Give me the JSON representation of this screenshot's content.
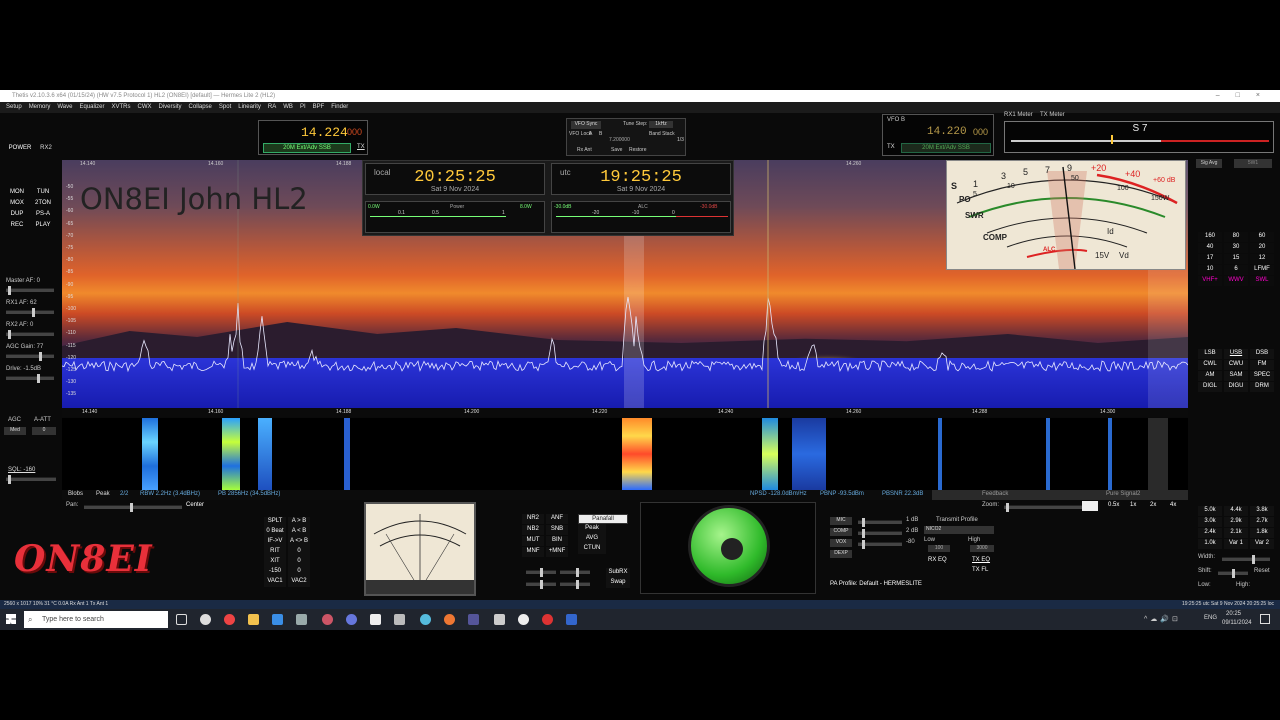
{
  "window": {
    "title": "Thetis v2.10.3.6 x64 (01/15/24) (HW v7.5 Protocol 1) HL2 (ON8EI) [default] — Hermes Lite 2 (HL2)"
  },
  "menu": [
    "Setup",
    "Memory",
    "Wave",
    "Equalizer",
    "XVTRs",
    "CWX",
    "Diversity",
    "Collapse",
    "Spot",
    "Linearity",
    "RA",
    "WB",
    "PI",
    "BPF",
    "Finder"
  ],
  "vfo_a": {
    "freq_main": "14.224",
    "freq_sub": "000",
    "band": "20M Ext/Adv SSB",
    "tx_label": "TX"
  },
  "vfo_b": {
    "label": "VFO B",
    "freq_main": "14.220",
    "freq_sub": "000",
    "band": "20M Ext/Adv SSB",
    "tx_label": "TX"
  },
  "vfo_sync": {
    "label": "VFO Sync",
    "tune_step_label": "Tune Step:",
    "tune_step": "1kHz",
    "vfo_lock": "VFO Lock",
    "a": "A",
    "b": "B",
    "rx_ant": "Rx Ant",
    "save": "Save",
    "restore": "Restore",
    "band_stack": "Band Stack",
    "bs_value": "1/3",
    "vfo_val": "7.200000"
  },
  "left_buttons": [
    "MON",
    "TUN",
    "MOX",
    "2TON",
    "DUP",
    "PS-A",
    "REC",
    "PLAY"
  ],
  "power": {
    "label": "POWER",
    "rx2": "RX2"
  },
  "left_sliders": [
    {
      "label": "Master AF: 0",
      "pos": 0.05
    },
    {
      "label": "RX1 AF: 62",
      "pos": 0.6
    },
    {
      "label": "RX2 AF: 0",
      "pos": 0.05
    },
    {
      "label": "AGC Gain: 77",
      "pos": 0.75
    },
    {
      "label": "Drive: -1.5dB",
      "pos": 0.7
    }
  ],
  "agc": {
    "label": "AGC",
    "att_label": "A-ATT",
    "agc_value": "Med",
    "att_value": "0",
    "sql_label": "SQL: -160"
  },
  "clocks": {
    "local": {
      "zone": "local",
      "time": "20:25:25",
      "date": "Sat 9 Nov 2024"
    },
    "utc": {
      "zone": "utc",
      "time": "19:25:25",
      "date": "Sat 9 Nov 2024"
    }
  },
  "power_meter": {
    "label": "Power",
    "min": "0.0W",
    "ticks": [
      "0.1",
      "0.5",
      "1"
    ],
    "max": "8.0W"
  },
  "alc_meter": {
    "label": "ALC",
    "min": "-30.0dB",
    "ticks": [
      "-20",
      "-10",
      "0"
    ],
    "max": "-30.0dB"
  },
  "callsign_overlay": "ON8EI John HL2",
  "rx_meter": {
    "label": "RX1 Meter",
    "tx_label": "TX Meter",
    "reading": "S 7",
    "sig_avg": "Sig Avg",
    "unit": "5W1"
  },
  "analog_scale": {
    "s_marks": [
      "1",
      "3",
      "5",
      "7",
      "9",
      "+20",
      "+40",
      "+60 dB"
    ],
    "po_marks": [
      "5",
      "10",
      "50",
      "100",
      "150W"
    ],
    "labels": [
      "S",
      "PO",
      "SWR",
      "COMP",
      "ALC",
      "Id",
      "Vd",
      "15V"
    ]
  },
  "db_scale": [
    "-50",
    "-55",
    "-60",
    "-65",
    "-70",
    "-75",
    "-80",
    "-85",
    "-90",
    "-95",
    "-100",
    "-105",
    "-110",
    "-115",
    "-120",
    "-125",
    "-130",
    "-135"
  ],
  "freq_scale_top": [
    "14.140",
    "14.160",
    "14.188",
    "14.260"
  ],
  "freq_scale": [
    "14.140",
    "14.160",
    "14.188",
    "14.200",
    "14.220",
    "14.240",
    "14.260",
    "14.288",
    "14.300"
  ],
  "band_buttons": [
    "160",
    "80",
    "60",
    "40",
    "30",
    "20",
    "17",
    "15",
    "12",
    "10",
    "6",
    "LFMF",
    "VHF+",
    "WWV",
    "SWL"
  ],
  "mode_buttons": [
    "LSB",
    "USB",
    "DSB",
    "CWL",
    "CWU",
    "FM",
    "AM",
    "SAM",
    "SPEC",
    "DIGL",
    "DIGU",
    "DRM"
  ],
  "filter_buttons": [
    "5.0k",
    "4.4k",
    "3.8k",
    "3.0k",
    "2.9k",
    "2.7k",
    "2.4k",
    "2.1k",
    "1.8k",
    "1.0k",
    "Var 1",
    "Var 2"
  ],
  "filter_labels": {
    "width": "Width:",
    "shift": "Shift:",
    "reset": "Reset",
    "low": "Low:",
    "high": "High:"
  },
  "pan_info": {
    "blobs": "Blobs",
    "peak": "Peak",
    "page": "2/2",
    "rbw": "RBW 2.2Hz (3.4dBHz)",
    "pb": "PB 2856Hz (34.5dBHz)",
    "npsd": "NPSD -128.0dBm/Hz",
    "pbnp": "PBNP -93.5dBm",
    "pbsnr": "PBSNR 22.3dB",
    "feedback": "Feedback",
    "pure_signal": "Pure Signal2",
    "zoom": "Zoom:",
    "zoom_steps": [
      "0.5x",
      "1x",
      "2x",
      "4x"
    ],
    "pan": "Pan:",
    "center": "Center"
  },
  "split_buttons": [
    "SPLT",
    "A > B",
    "0 Beat",
    "A < B",
    "IF->V",
    "A <> B",
    "RIT",
    "0",
    "XIT",
    "0",
    "-150",
    "0",
    "VAC1",
    "VAC2"
  ],
  "dsp_buttons": [
    "NR2",
    "ANF",
    "NB2",
    "SNB",
    "MUT",
    "BIN",
    "MNF",
    "+MNF",
    "Panafall",
    "Peak",
    "AVG",
    "CTUN",
    "SubRX",
    "Swap"
  ],
  "tx_panel": {
    "mic": "MIC",
    "comp": "COMP",
    "vox": "VOX",
    "dexp": "DEXP",
    "mic_val": "1 dB",
    "comp_val": "2 dB",
    "vox_val": "-80",
    "tx_profile_label": "Transmit Profile",
    "tx_profile": "NICO2",
    "low": "Low",
    "low_val": "100",
    "high": "High",
    "high_val": "3000",
    "rx_eq": "RX EQ",
    "tx_eq": "TX EQ",
    "tx_fl": "TX FL",
    "pa_profile": "PA Profile: Default - HERMESLITE"
  },
  "logo_text": "ON8EI",
  "statusbar": {
    "left": "2560 x 1017     10%    31 °C  0.0A    Rx Ant 1    Tx Ant 1",
    "right": "19:25:25 utc    Sat 9 Nov 2024    20:25:25 loc"
  },
  "taskbar": {
    "search": "Type here to search",
    "lang": "ENG",
    "time": "20:25",
    "date": "09/11/2024"
  },
  "colors": {
    "vfo_freq": "#ffc93a",
    "logo": "#e8303a",
    "knob": "#2fba2a",
    "sky": "#f08a2c",
    "noise": "#1a1ab6"
  }
}
